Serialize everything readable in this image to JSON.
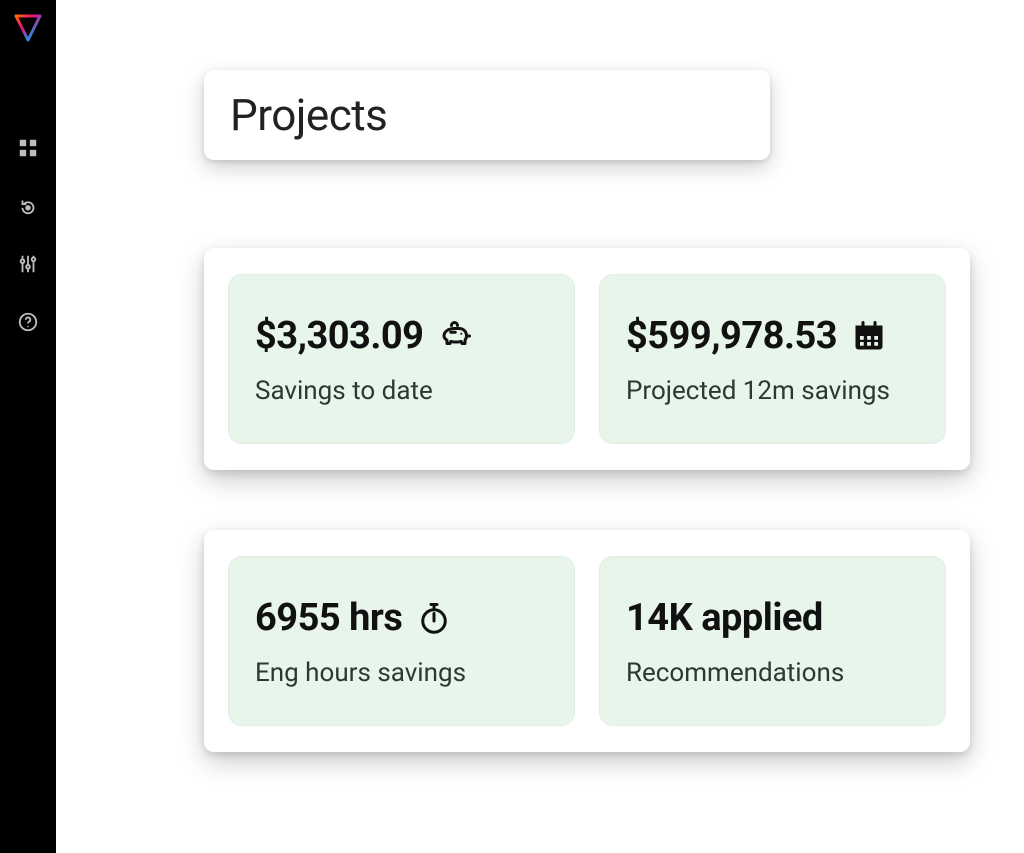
{
  "sidebar": {
    "items": [
      {
        "name": "dashboard"
      },
      {
        "name": "refresh-cycle"
      },
      {
        "name": "sliders"
      },
      {
        "name": "help"
      }
    ]
  },
  "header": {
    "title": "Projects"
  },
  "stats": {
    "savings_to_date": {
      "value": "$3,303.09",
      "label": "Savings to date",
      "icon": "piggy-bank-icon"
    },
    "projected_12m": {
      "value": "$599,978.53",
      "label": "Projected 12m savings",
      "icon": "calendar-icon"
    },
    "eng_hours": {
      "value": "6955 hrs",
      "label": "Eng hours savings",
      "icon": "stopwatch-icon"
    },
    "recommendations": {
      "value": "14K applied",
      "label": "Recommendations",
      "icon": null
    }
  }
}
